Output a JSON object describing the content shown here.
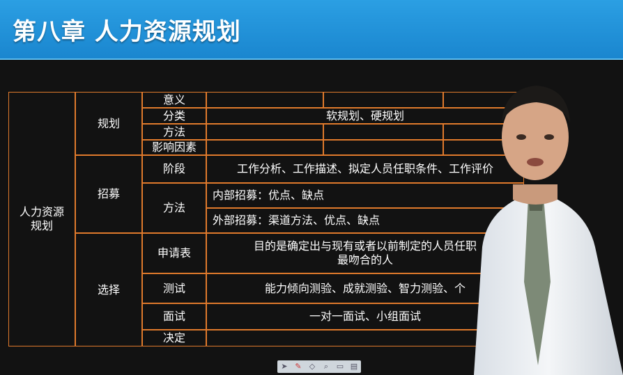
{
  "title": "第八章 人力资源规划",
  "table": {
    "root": "人力资源\n规划",
    "groups": {
      "planning": "规划",
      "recruit": "招募",
      "select": "选择"
    },
    "rows": {
      "meaning": "意义",
      "category": "分类",
      "category_val": "软规划、硬规划",
      "method": "方法",
      "factors": "影响因素",
      "stage": "阶段",
      "stage_val": "工作分析、工作描述、拟定人员任职条件、工作评价",
      "recruit_method": "方法",
      "internal": "内部招募：优点、缺点",
      "external": "外部招募：渠道方法、优点、缺点",
      "application": "申请表",
      "application_val": "目的是确定出与现有或者以前制定的人员任职\n最吻合的人",
      "test": "测试",
      "test_val": "能力倾向测验、成就测验、智力测验、个",
      "interview": "面试",
      "interview_val": "一对一面试、小组面试",
      "decision": "决定"
    }
  },
  "toolbar": {
    "icons": [
      "pointer-icon",
      "pen-icon",
      "eraser-icon",
      "zoom-icon",
      "comment-icon",
      "trash-icon"
    ]
  },
  "colors": {
    "header_blue": "#1a86cf",
    "table_border": "#e07a2c",
    "text": "#ffffff"
  }
}
